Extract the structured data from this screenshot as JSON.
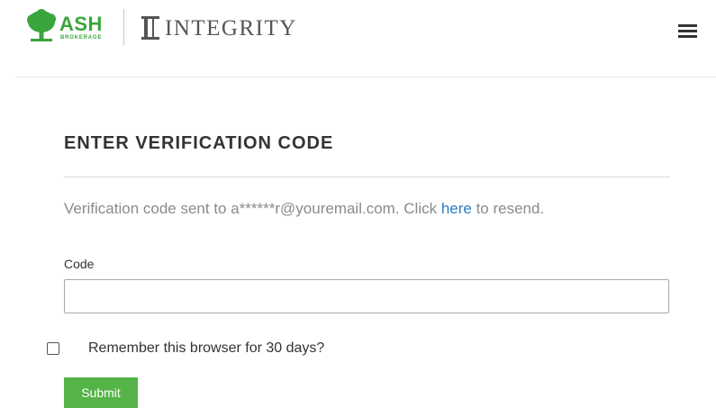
{
  "header": {
    "ash_logo": {
      "name": "ASH",
      "tagline": "BROKERAGE"
    },
    "integrity_logo": {
      "name": "INTEGRITY"
    },
    "menu_icon": "hamburger-menu-icon"
  },
  "form": {
    "title": "ENTER VERIFICATION CODE",
    "info_prefix": "Verification code sent to a******r@youremail.com. Click ",
    "resend_link": "here",
    "info_suffix": " to resend.",
    "code_label": "Code",
    "code_value": "",
    "remember_label": "Remember this browser for 30 days?",
    "remember_checked": false,
    "submit_label": "Submit"
  },
  "colors": {
    "ash_green": "#3aa53d",
    "submit_green": "#55b447",
    "link_blue": "#2a7dc4",
    "info_gray": "#8a8a8a",
    "text_dark": "#333333"
  }
}
